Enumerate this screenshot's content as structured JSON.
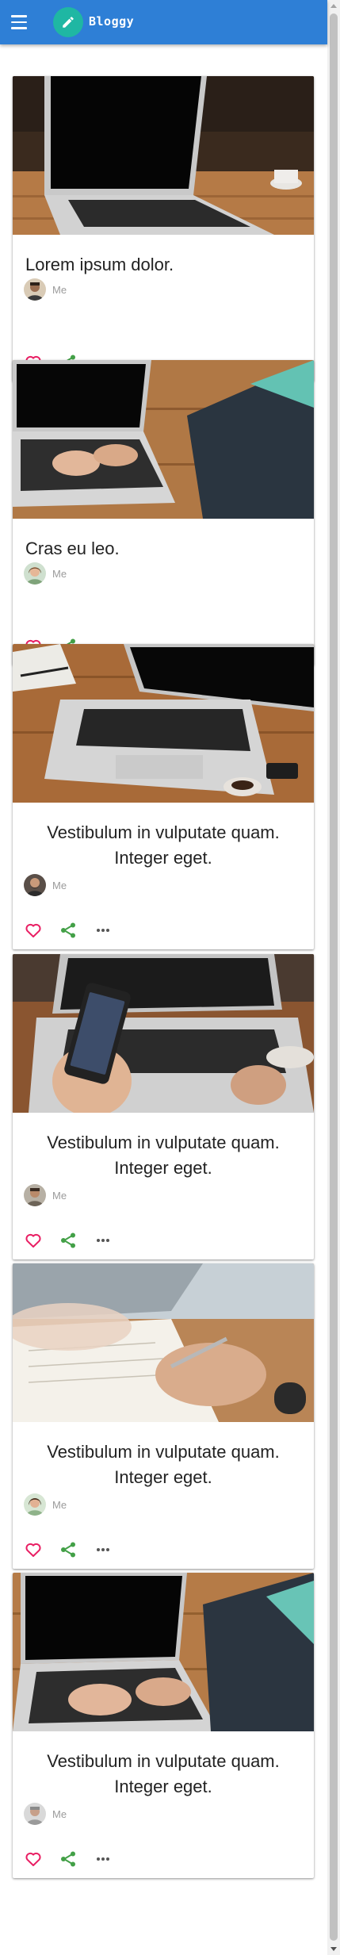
{
  "app": {
    "title": "Bloggy",
    "accent": "#2e7fd6",
    "logo_color": "#1fb7a3",
    "menu_icon": "menu-icon",
    "logo_icon": "pencil-icon"
  },
  "posts": [
    {
      "title": "Lorem ipsum dolor.",
      "author": "Me",
      "image": "laptop-on-wooden-desk",
      "avatar": "man-avatar"
    },
    {
      "title": "Cras eu leo.",
      "author": "Me",
      "image": "hands-typing-on-laptop",
      "avatar": "woman-avatar"
    },
    {
      "title": "Vestibulum in vulputate quam. Integer eget.",
      "author": "Me",
      "image": "laptop-with-coffee-cup",
      "avatar": "bearded-man-avatar"
    },
    {
      "title": "Vestibulum in vulputate quam. Integer eget.",
      "author": "Me",
      "image": "hand-holding-smartphone",
      "avatar": "man-avatar"
    },
    {
      "title": "Vestibulum in vulputate quam. Integer eget.",
      "author": "Me",
      "image": "hand-writing-with-pen",
      "avatar": "woman-avatar"
    },
    {
      "title": "Vestibulum in vulputate quam. Integer eget.",
      "author": "Me",
      "image": "typing-on-laptop-side-view",
      "avatar": "older-man-avatar"
    }
  ],
  "actions": {
    "like_icon": "heart-icon",
    "share_icon": "share-icon",
    "more_icon": "more-horizontal-icon",
    "like_color": "#e91e63",
    "share_color": "#43a047",
    "more_color": "#555555"
  }
}
